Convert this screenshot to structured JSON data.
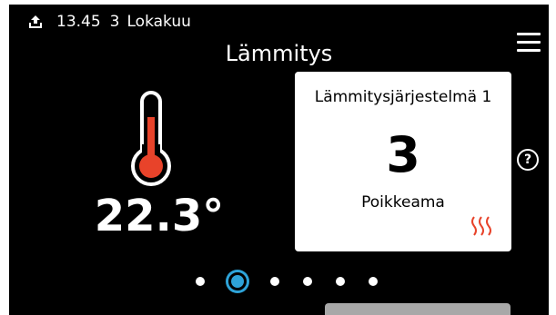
{
  "status": {
    "time": "13.45",
    "day": "3",
    "month": "Lokakuu",
    "icon": "upload-icon"
  },
  "header": {
    "title": "Lämmitys",
    "menu_icon": "hamburger-menu-icon"
  },
  "thermometer": {
    "icon": "thermometer-icon",
    "temperature": "22.3°",
    "mercury_color": "#e8432a"
  },
  "card": {
    "title": "Lämmitysjärjestelmä 1",
    "value": "3",
    "label": "Poikkeama",
    "heat_icon": "heat-waves-icon",
    "heat_color": "#e8432a"
  },
  "help": {
    "label": "?"
  },
  "pagination": {
    "count": 6,
    "active_index": 1,
    "active_color": "#2ea3d8"
  }
}
